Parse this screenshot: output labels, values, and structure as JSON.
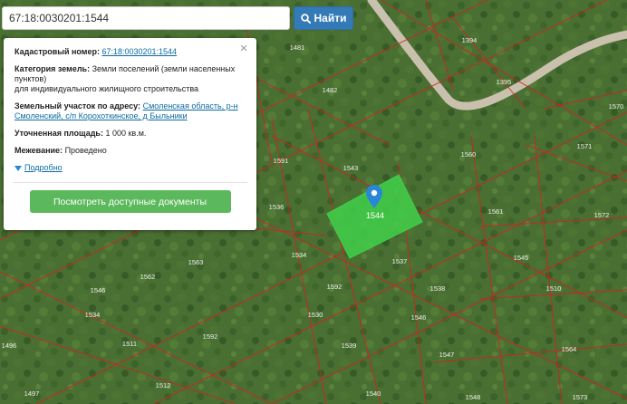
{
  "search": {
    "value": "67:18:0030201:1544",
    "button_label": "Найти"
  },
  "popup": {
    "cadastral_label": "Кадастровый номер:",
    "cadastral_value": "67:18:0030201:1544",
    "category_label": "Категория земель:",
    "category_value": "Земли поселений (земли населенных пунктов)",
    "usage_value": "для индивидуального жилищного строительства",
    "address_label": "Земельный участок по адресу:",
    "address_value": "Смоленская область, р-н Смоленский, с/п Корохоткинское, д Быльники",
    "area_label": "Уточненная площадь:",
    "area_value": "1 000 кв.м.",
    "survey_label": "Межевание:",
    "survey_value": "Проведено",
    "more_label": "Подробно",
    "docs_button": "Посмотреть доступные документы"
  },
  "map": {
    "highlight_color": "#3fd14a",
    "parcel_line_color": "#d42020",
    "selected_label": "1544",
    "parcel_labels": [
      "1394",
      "1481",
      "1395",
      "1482",
      "1591",
      "1543",
      "1560",
      "1571",
      "1536",
      "1561",
      "1572",
      "1534",
      "1537",
      "1545",
      "1562",
      "1592",
      "1538",
      "1546",
      "1510",
      "1563",
      "1534",
      "1530",
      "1546",
      "1592",
      "1511",
      "1539",
      "1564",
      "1496",
      "1547",
      "1512",
      "1497",
      "1540",
      "1548",
      "1573",
      "1570"
    ]
  }
}
